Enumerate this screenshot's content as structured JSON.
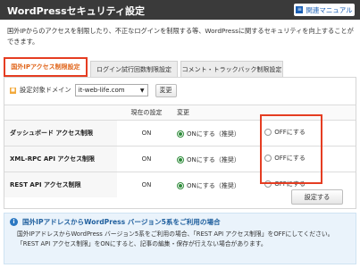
{
  "header": {
    "title": "WordPressセキュリティ設定",
    "manual_label": "関連マニュアル"
  },
  "intro_text": "国外IPからのアクセスを制限したり、不正なログインを制限する等、WordPressに関するセキュリティを向上することができます。",
  "tabs": [
    {
      "label": "国外IPアクセス制限設定",
      "active": true
    },
    {
      "label": "ログイン試行回数制限設定",
      "active": false
    },
    {
      "label": "コメント・トラックバック制限設定",
      "active": false
    }
  ],
  "domain": {
    "label": "設定対象ドメイン",
    "selected": "it-web-life.com",
    "change_label": "変更"
  },
  "table": {
    "headers": {
      "name": "",
      "current": "現在の設定",
      "change": "変更"
    },
    "rows": [
      {
        "label": "ダッシュボード アクセス制限",
        "current": "ON",
        "on_option": "ONにする（推奨）",
        "off_option": "OFFにする"
      },
      {
        "label": "XML-RPC API アクセス制限",
        "current": "ON",
        "on_option": "ONにする（推奨）",
        "off_option": "OFFにする"
      },
      {
        "label": "REST API アクセス制限",
        "current": "ON",
        "on_option": "ONにする（推奨）",
        "off_option": "OFFにする"
      }
    ]
  },
  "save_label": "設定する",
  "notice": {
    "title": "国外IPアドレスからWordPress バージョン5系をご利用の場合",
    "body": "国外IPアドレスからWordPress バージョン5系をご利用の場合、「REST API アクセス制限」をOFFにしてください。「REST API アクセス制限」をONにすると、記事の編集・保存が行えない場合があります。"
  },
  "colors": {
    "header_bg": "#3a3a3a",
    "highlight": "#e53d22",
    "accent_green": "#2e8b3a",
    "link_blue": "#1a5fb4"
  }
}
